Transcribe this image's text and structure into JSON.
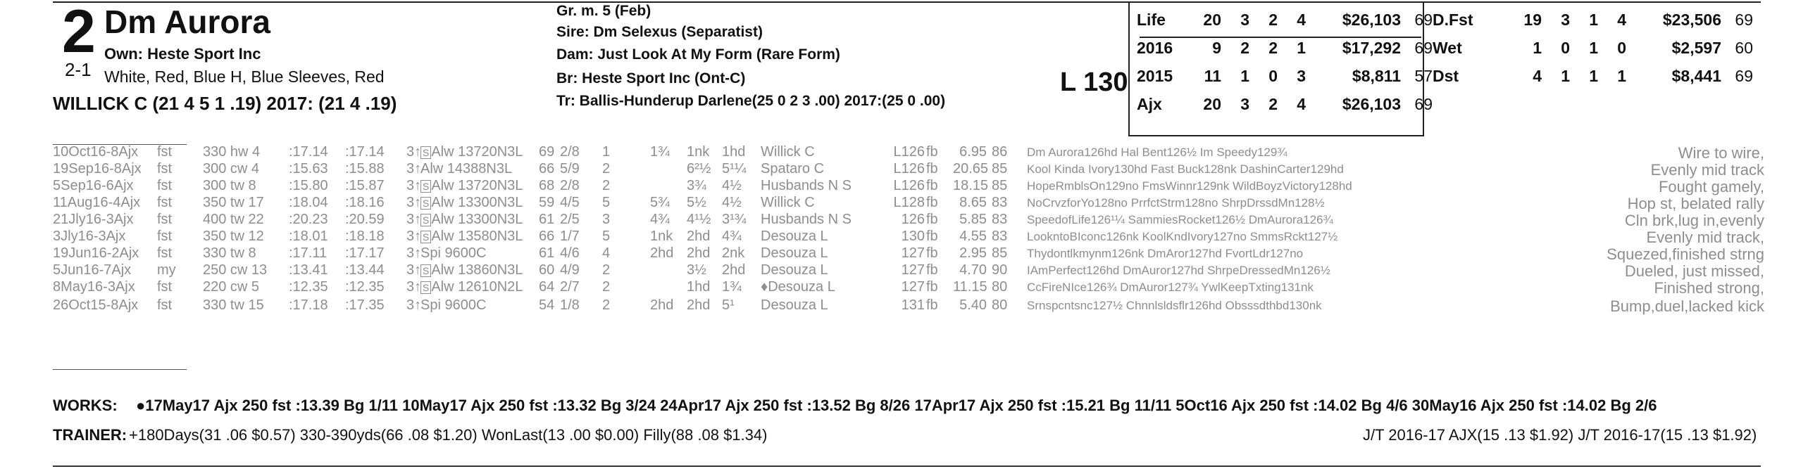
{
  "header": {
    "program_number": "2",
    "horse_name": "Dm Aurora",
    "owner": "Own: Heste Sport Inc",
    "morning_line": "2-1",
    "silks": "White, Red, Blue H, Blue Sleeves, Red",
    "jockey": "WILLICK C (21 4 5 1 .19) 2017: (21 4 .19)",
    "sex_age": "Gr. m. 5 (Feb)",
    "sire": "Sire: Dm Selexus (Separatist)",
    "dam": "Dam: Just Look At My Form (Rare Form)",
    "breeder": "Br:   Heste Sport Inc (Ont-C)",
    "trainer": "Tr:   Ballis-Hunderup Darlene(25 0 2 3 .00)  2017:(25 0 .00)",
    "weight": "L 130"
  },
  "records_left": [
    {
      "label": "Life",
      "st": "20",
      "w": "3",
      "p": "2",
      "s": "4",
      "earn": "$26,103",
      "spd": "69"
    },
    {
      "label": "2016",
      "st": "9",
      "w": "2",
      "p": "2",
      "s": "1",
      "earn": "$17,292",
      "spd": "69"
    },
    {
      "label": "2015",
      "st": "11",
      "w": "1",
      "p": "0",
      "s": "3",
      "earn": "$8,811",
      "spd": "57"
    },
    {
      "label": "Ajx",
      "st": "20",
      "w": "3",
      "p": "2",
      "s": "4",
      "earn": "$26,103",
      "spd": "69"
    }
  ],
  "records_right": [
    {
      "label": "D.Fst",
      "st": "19",
      "w": "3",
      "p": "1",
      "s": "4",
      "earn": "$23,506",
      "spd": "69"
    },
    {
      "label": "Wet",
      "st": "1",
      "w": "0",
      "p": "1",
      "s": "0",
      "earn": "$2,597",
      "spd": "60"
    },
    {
      "label": "Dst",
      "st": "4",
      "w": "1",
      "p": "1",
      "s": "1",
      "earn": "$8,441",
      "spd": "69"
    }
  ],
  "past_performances": [
    {
      "date": "10Oct16-8Ajx",
      "cond": "fst",
      "dist": "330 hw 4",
      "t1": ":17.14",
      "t2": ":17.14",
      "age": "3↑",
      "s": true,
      "race": "Alw 13720N3L",
      "spd": "69",
      "pp": "2/8",
      "st": "1",
      "c1": "",
      "c2": "1¾",
      "c3": "1nk",
      "fin": "1hd",
      "jockey": "Willick C",
      "wt": "L126",
      "eq": "fb",
      "odds": "6.95",
      "sr": "86",
      "top3": "Dm Aurora126hd Hal Bent126½ Im Speedy129¾",
      "comment": "Wire to wire,"
    },
    {
      "date": "19Sep16-8Ajx",
      "cond": "fst",
      "dist": "300 cw 4",
      "t1": ":15.63",
      "t2": ":15.88",
      "age": "3↑",
      "s": false,
      "race": "Alw 14388N3L",
      "spd": "66",
      "pp": "5/9",
      "st": "2",
      "c1": "",
      "c2": "",
      "c3": "6²½",
      "fin": "5¹¼",
      "jockey": "Spataro C",
      "wt": "L126",
      "eq": "fb",
      "odds": "20.65",
      "sr": "85",
      "top3": "Kool Kinda Ivory130hd Fast Buck128nk DashinCarter129hd",
      "comment": "Evenly mid track"
    },
    {
      "date": "5Sep16-6Ajx",
      "cond": "fst",
      "dist": "300 tw 8",
      "t1": ":15.80",
      "t2": ":15.87",
      "age": "3↑",
      "s": true,
      "race": "Alw 13720N3L",
      "spd": "68",
      "pp": "2/8",
      "st": "2",
      "c1": "",
      "c2": "",
      "c3": "3¾",
      "fin": "4½",
      "jockey": "Husbands N S",
      "wt": "L126",
      "eq": "fb",
      "odds": "18.15",
      "sr": "85",
      "top3": "HopeRmblsOn129no FmsWinnr129nk WildBoyzVictory128hd",
      "comment": "Fought gamely,"
    },
    {
      "date": "11Aug16-4Ajx",
      "cond": "fst",
      "dist": "350 tw 17",
      "t1": ":18.04",
      "t2": ":18.16",
      "age": "3↑",
      "s": true,
      "race": "Alw 13300N3L",
      "spd": "59",
      "pp": "4/5",
      "st": "5",
      "c1": "",
      "c2": "5¾",
      "c3": "5½",
      "fin": "4½",
      "jockey": "Willick C",
      "wt": "L128",
      "eq": "fb",
      "odds": "8.65",
      "sr": "83",
      "top3": "NoCrvzforYo128no PrrfctStrm128no ShrpDrssdMn128½",
      "comment": "Hop st, belated rally"
    },
    {
      "date": "21Jly16-3Ajx",
      "cond": "fst",
      "dist": "400 tw 22",
      "t1": ":20.23",
      "t2": ":20.59",
      "age": "3↑",
      "s": true,
      "race": "Alw 13300N3L",
      "spd": "61",
      "pp": "2/5",
      "st": "3",
      "c1": "",
      "c2": "4¾",
      "c3": "4¹½",
      "fin": "3¹¾",
      "jockey": "Husbands N S",
      "wt": "126",
      "eq": "fb",
      "odds": "5.85",
      "sr": "83",
      "top3": "SpeedofLife126¹¼ SammiesRocket126½ DmAurora126¾",
      "comment": "Cln brk,lug in,evenly"
    },
    {
      "date": "3Jly16-3Ajx",
      "cond": "fst",
      "dist": "350 tw 12",
      "t1": ":18.01",
      "t2": ":18.18",
      "age": "3↑",
      "s": true,
      "race": "Alw 13580N3L",
      "spd": "66",
      "pp": "1/7",
      "st": "5",
      "c1": "",
      "c2": "1nk",
      "c3": "2hd",
      "fin": "4¾",
      "jockey": "Desouza L",
      "wt": "130",
      "eq": "fb",
      "odds": "4.55",
      "sr": "83",
      "top3": "LookntoBIconc126nk KoolKndIvory127no SmmsRckt127½",
      "comment": "Evenly mid track,"
    },
    {
      "date": "19Jun16-2Ajx",
      "cond": "fst",
      "dist": "330 tw 8",
      "t1": ":17.11",
      "t2": ":17.17",
      "age": "3↑",
      "s": false,
      "race": "Spi 9600C",
      "spd": "61",
      "pp": "4/6",
      "st": "4",
      "c1": "",
      "c2": "2hd",
      "c3": "2hd",
      "fin": "2nk",
      "jockey": "Desouza L",
      "wt": "127",
      "eq": "fb",
      "odds": "2.95",
      "sr": "85",
      "top3": "Thydontlkmynm126nk DmAror127hd FvortLdr127no",
      "comment": "Squezed,finished strng"
    },
    {
      "date": "5Jun16-7Ajx",
      "cond": "my",
      "dist": "250 cw 13",
      "t1": ":13.41",
      "t2": ":13.44",
      "age": "3↑",
      "s": true,
      "race": "Alw 13860N3L",
      "spd": "60",
      "pp": "4/9",
      "st": "2",
      "c1": "",
      "c2": "",
      "c3": "3½",
      "fin": "2hd",
      "jockey": "Desouza L",
      "wt": "127",
      "eq": "fb",
      "odds": "4.70",
      "sr": "90",
      "top3": "IAmPerfect126hd DmAuror127hd ShrpeDressedMn126½",
      "comment": "Dueled, just missed,"
    },
    {
      "date": "8May16-3Ajx",
      "cond": "fst",
      "dist": "220 cw 5",
      "t1": ":12.35",
      "t2": ":12.35",
      "age": "3↑",
      "s": true,
      "race": "Alw 12610N2L",
      "spd": "64",
      "pp": "2/7",
      "st": "2",
      "c1": "",
      "c2": "",
      "c3": "1hd",
      "fin": "1¾",
      "jockey": "♦Desouza L",
      "wt": "127",
      "eq": "fb",
      "odds": "11.15",
      "sr": "80",
      "top3": "CcFireNIce126¾ DmAuror127¾ YwlKeepTxting131nk",
      "comment": "Finished strong,"
    },
    {
      "date": "26Oct15-8Ajx",
      "cond": "fst",
      "dist": "330 tw 15",
      "t1": ":17.18",
      "t2": ":17.35",
      "age": "3↑",
      "s": false,
      "race": "Spi 9600C",
      "spd": "54",
      "pp": "1/8",
      "st": "2",
      "c1": "",
      "c2": "2hd",
      "c3": "2hd",
      "fin": "5¹",
      "jockey": "Desouza L",
      "wt": "131",
      "eq": "fb",
      "odds": "5.40",
      "sr": "80",
      "top3": "Srnspcntsnc127½ Chnnlsldsflr126hd Obsssdthbd130nk",
      "comment": "Bump,duel,lacked kick"
    }
  ],
  "works": {
    "label": "WORKS:",
    "items": "●17May17 Ajx 250 fst :13.39 Bg 1/11   10May17 Ajx 250 fst :13.32 Bg 3/24   24Apr17 Ajx 250 fst :13.52 Bg 8/26   17Apr17 Ajx 250 fst :15.21 Bg 11/11   5Oct16 Ajx 250 fst :14.02 Bg 4/6   30May16 Ajx 250 fst :14.02 Bg 2/6"
  },
  "trainer_stats": {
    "label": "TRAINER:",
    "text": "+180Days(31 .06 $0.57) 330-390yds(66 .08 $1.20) WonLast(13 .00 $0.00) Filly(88 .08 $1.34)",
    "jt": "J/T 2016-17 AJX(15 .13 $1.92)  J/T 2016-17(15 .13 $1.92)"
  }
}
